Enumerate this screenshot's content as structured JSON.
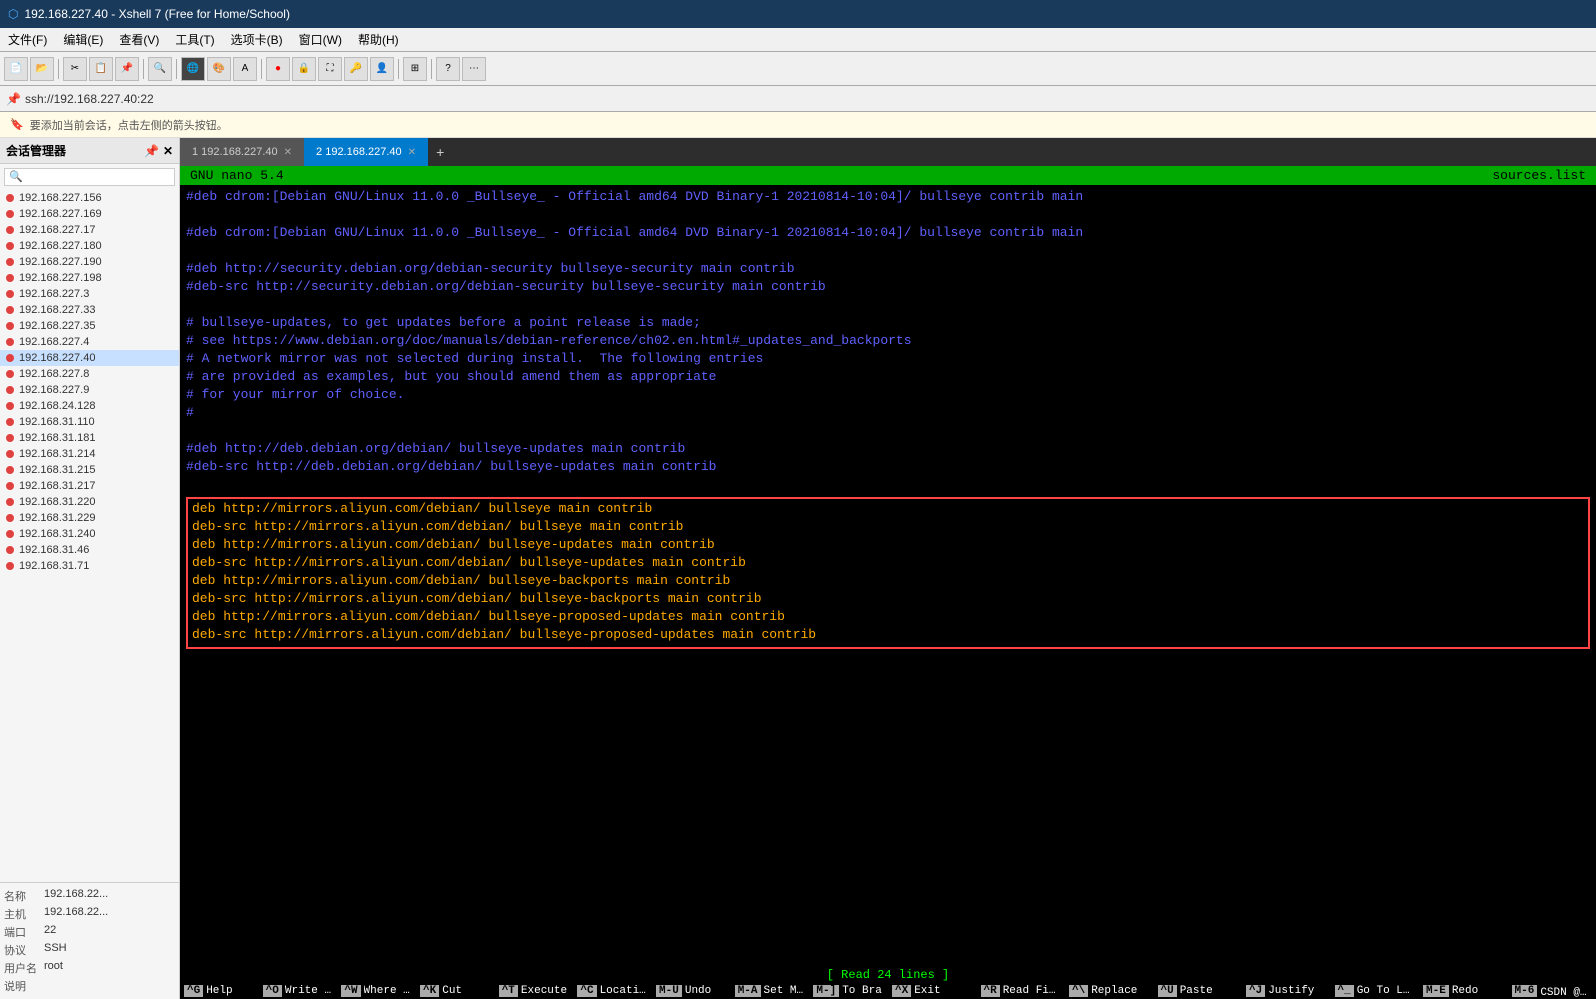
{
  "titleBar": {
    "icon": "xshell-icon",
    "title": "192.168.227.40 - Xshell 7 (Free for Home/School)"
  },
  "menuBar": {
    "items": [
      "文件(F)",
      "编辑(E)",
      "查看(V)",
      "工具(T)",
      "选项卡(B)",
      "窗口(W)",
      "帮助(H)"
    ]
  },
  "addressBar": {
    "text": "ssh://192.168.227.40:22"
  },
  "infoBar": {
    "text": "要添加当前会话，点击左侧的箭头按钮。"
  },
  "sidebar": {
    "title": "会话管理器",
    "items": [
      "192.168.227.156",
      "192.168.227.169",
      "192.168.227.17",
      "192.168.227.180",
      "192.168.227.190",
      "192.168.227.198",
      "192.168.227.3",
      "192.168.227.33",
      "192.168.227.35",
      "192.168.227.4",
      "192.168.227.40",
      "192.168.227.8",
      "192.168.227.9",
      "192.168.24.128",
      "192.168.31.110",
      "192.168.31.181",
      "192.168.31.214",
      "192.168.31.215",
      "192.168.31.217",
      "192.168.31.220",
      "192.168.31.229",
      "192.168.31.240",
      "192.168.31.46",
      "192.168.31.71"
    ],
    "activeItem": "192.168.227.40"
  },
  "sessionInfo": {
    "fields": [
      {
        "label": "名称",
        "value": "192.168.22..."
      },
      {
        "label": "主机",
        "value": "192.168.22..."
      },
      {
        "label": "端口",
        "value": "22"
      },
      {
        "label": "协议",
        "value": "SSH"
      },
      {
        "label": "用户名",
        "value": "root"
      },
      {
        "label": "说明",
        "value": ""
      }
    ]
  },
  "tabs": [
    {
      "id": 1,
      "label": "1 192.168.227.40",
      "active": false
    },
    {
      "id": 2,
      "label": "2 192.168.227.40",
      "active": true
    }
  ],
  "nano": {
    "title_left": "GNU nano 5.4",
    "title_right": "sources.list",
    "lines": [
      {
        "type": "comment",
        "text": "#deb cdrom:[Debian GNU/Linux 11.0.0 _Bullseye_ - Official amd64 DVD Binary-1 20210814-10:04]/ bullseye contrib main"
      },
      {
        "type": "empty",
        "text": ""
      },
      {
        "type": "comment",
        "text": "#deb cdrom:[Debian GNU/Linux 11.0.0 _Bullseye_ - Official amd64 DVD Binary-1 20210814-10:04]/ bullseye contrib main"
      },
      {
        "type": "empty",
        "text": ""
      },
      {
        "type": "comment",
        "text": "#deb http://security.debian.org/debian-security bullseye-security main contrib"
      },
      {
        "type": "comment",
        "text": "#deb-src http://security.debian.org/debian-security bullseye-security main contrib"
      },
      {
        "type": "empty",
        "text": ""
      },
      {
        "type": "comment",
        "text": "# bullseye-updates, to get updates before a point release is made;"
      },
      {
        "type": "comment",
        "text": "# see https://www.debian.org/doc/manuals/debian-reference/ch02.en.html#_updates_and_backports"
      },
      {
        "type": "comment",
        "text": "# A network mirror was not selected during install.  The following entries"
      },
      {
        "type": "comment",
        "text": "# are provided as examples, but you should amend them as appropriate"
      },
      {
        "type": "comment",
        "text": "# for your mirror of choice."
      },
      {
        "type": "comment",
        "text": "#"
      },
      {
        "type": "empty",
        "text": ""
      },
      {
        "type": "comment",
        "text": "#deb http://deb.debian.org/debian/ bullseye-updates main contrib"
      },
      {
        "type": "comment",
        "text": "#deb-src http://deb.debian.org/debian/ bullseye-updates main contrib"
      },
      {
        "type": "empty",
        "text": ""
      }
    ],
    "highlightedLines": [
      "deb http://mirrors.aliyun.com/debian/ bullseye main contrib",
      "deb-src http://mirrors.aliyun.com/debian/ bullseye main contrib",
      "deb http://mirrors.aliyun.com/debian/ bullseye-updates main contrib",
      "deb-src http://mirrors.aliyun.com/debian/ bullseye-updates main contrib",
      "deb http://mirrors.aliyun.com/debian/ bullseye-backports main contrib",
      "deb-src http://mirrors.aliyun.com/debian/ bullseye-backports main contrib",
      "deb http://mirrors.aliyun.com/debian/ bullseye-proposed-updates main contrib",
      "deb-src http://mirrors.aliyun.com/debian/ bullseye-proposed-updates main contrib"
    ],
    "statusLine": "[ Read 24 lines ]",
    "shortcuts": [
      [
        {
          "key": "^G",
          "label": "Help"
        },
        {
          "key": "^O",
          "label": "Write Out"
        },
        {
          "key": "^W",
          "label": "Where Is"
        },
        {
          "key": "^K",
          "label": "Cut"
        },
        {
          "key": "^T",
          "label": "Execute"
        },
        {
          "key": "^C",
          "label": "Location"
        },
        {
          "key": "M-U",
          "label": "Undo"
        },
        {
          "key": "M-A",
          "label": "Set Mark"
        },
        {
          "key": "M-]",
          "label": "To Bra"
        }
      ],
      [
        {
          "key": "^X",
          "label": "Exit"
        },
        {
          "key": "^R",
          "label": "Read File"
        },
        {
          "key": "^\\",
          "label": "Replace"
        },
        {
          "key": "^U",
          "label": "Paste"
        },
        {
          "key": "^J",
          "label": "Justify"
        },
        {
          "key": "^_",
          "label": "Go To Line"
        },
        {
          "key": "M-E",
          "label": "Redo"
        },
        {
          "key": "M-6",
          "label": "CSDN @下雨的太阳W"
        }
      ]
    ]
  }
}
